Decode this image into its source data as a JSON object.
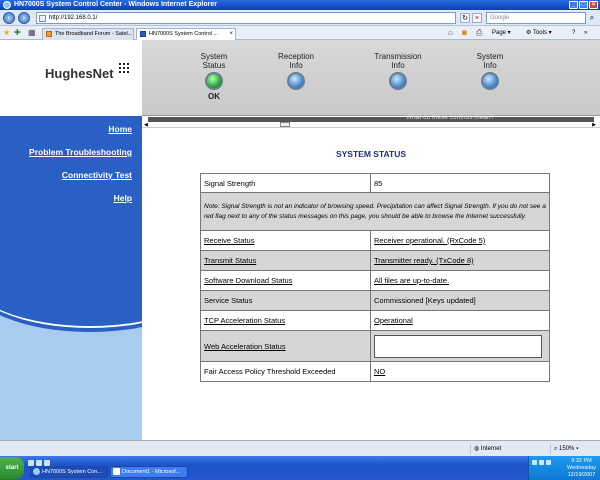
{
  "window": {
    "title": "HN7000S System Control Center - Windows Internet Explorer"
  },
  "browser": {
    "url": "http://192.168.0.1/",
    "search_placeholder": "Google",
    "tabs": [
      {
        "label": "The Broadband Forum - Satel..."
      },
      {
        "label": "HN7000S System Control ..."
      }
    ],
    "commands": {
      "page": "Page",
      "tools": "Tools"
    }
  },
  "header": {
    "logo": "HughesNet",
    "indicators": [
      {
        "label_line1": "System",
        "label_line2": "Status",
        "value": "OK",
        "color": "#2aa832"
      },
      {
        "label_line1": "Reception",
        "label_line2": "Info",
        "color": "#3a7fc8"
      },
      {
        "label_line1": "Transmission",
        "label_line2": "Info",
        "color": "#3a7fc8"
      },
      {
        "label_line1": "System",
        "label_line2": "Info",
        "color": "#3a7fc8"
      }
    ],
    "ticker": "What do these controls mean?"
  },
  "sidebar": {
    "items": [
      {
        "label": "Home"
      },
      {
        "label": "Problem Troubleshooting"
      },
      {
        "label": "Connectivity Test"
      },
      {
        "label": "Help"
      }
    ]
  },
  "main": {
    "title": "SYSTEM STATUS",
    "signal_label": "Signal Strength",
    "signal_value": "85",
    "note": "Note: Signal Strength is not an indicator of browsing speed. Precipitation can affect Signal Strength. If you do not see a red flag next to any of the status messages on this page, you should be able to browse the Internet successfully.",
    "rows": [
      {
        "label": "Receive Status",
        "value": "Receiver operational. (RxCode 5)"
      },
      {
        "label": "Transmit Status",
        "value": "Transmitter ready. (TxCode 8)"
      },
      {
        "label": "Software Download Status",
        "value": "All files are up-to-date."
      },
      {
        "label": "Service Status",
        "value": "Commissioned  [Keys updated]"
      },
      {
        "label": "TCP Acceleration Status",
        "value": "Operational"
      },
      {
        "label": "Web Acceleration Status",
        "value": ""
      },
      {
        "label": "Fair Access Policy Threshold Exceeded",
        "value": "NO"
      }
    ]
  },
  "statusbar": {
    "zone": "Internet",
    "zoom": "150%"
  },
  "taskbar": {
    "start": "start",
    "tasks": [
      {
        "label": "HN7000S System Con..."
      },
      {
        "label": "Document1 - Microsof..."
      }
    ],
    "clock_time": "9:32 PM",
    "clock_day": "Wednesday",
    "clock_date": "12/19/2007"
  }
}
